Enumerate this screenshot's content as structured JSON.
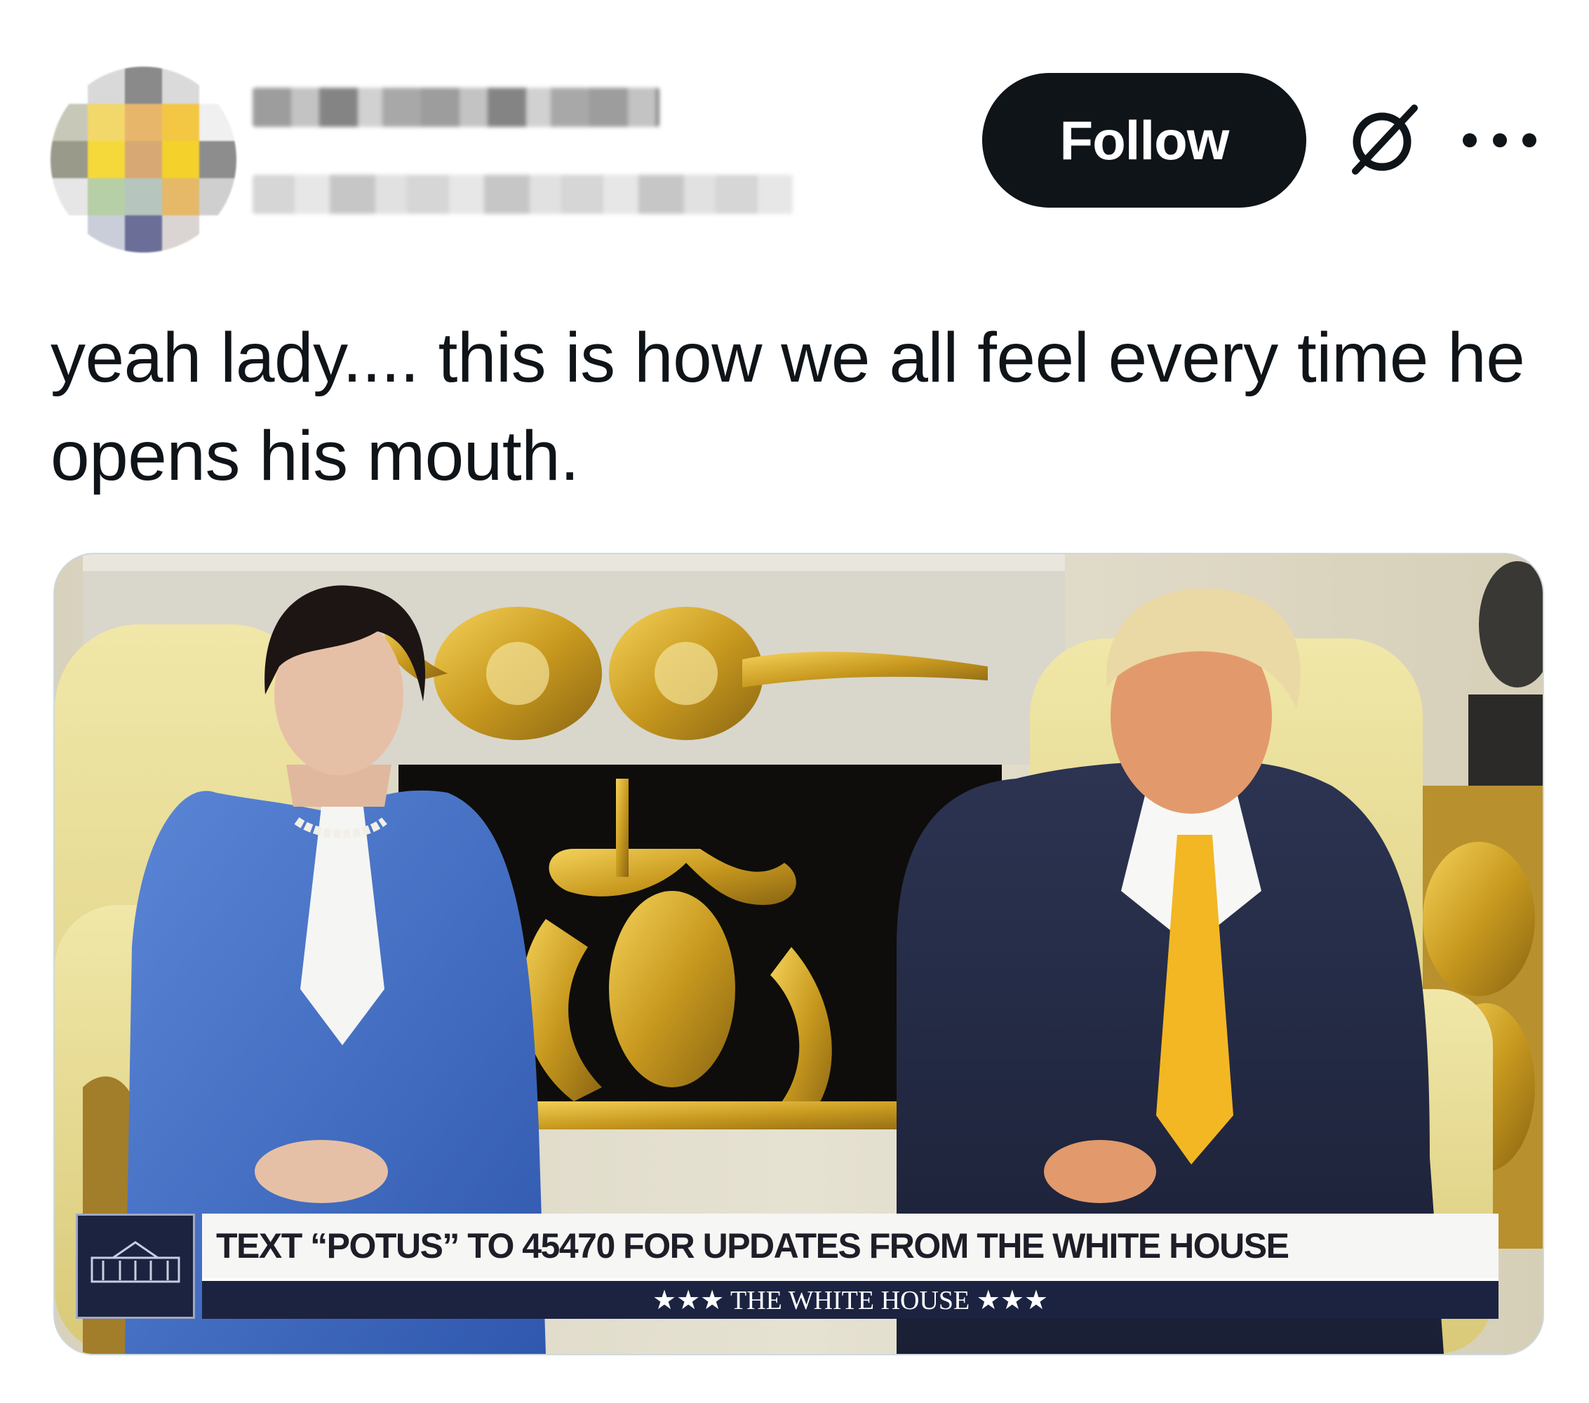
{
  "post": {
    "author_display_name": "",
    "author_handle": "",
    "follow_label": "Follow",
    "text": "yeah lady.... this is how we all feel every time he opens his mouth."
  },
  "icons": {
    "grok": "grok-icon",
    "more": "more-options-icon",
    "avatar": "pixelated-avatar"
  },
  "media": {
    "caption_main": "TEXT “POTUS” TO 45470 FOR UPDATES FROM THE WHITE HOUSE",
    "caption_sub": "★★★  THE WHITE HOUSE  ★★★"
  },
  "colors": {
    "follow_bg": "#0f1419",
    "follow_text": "#ffffff",
    "text": "#0f1419",
    "banner_navy": "#1b2341"
  }
}
